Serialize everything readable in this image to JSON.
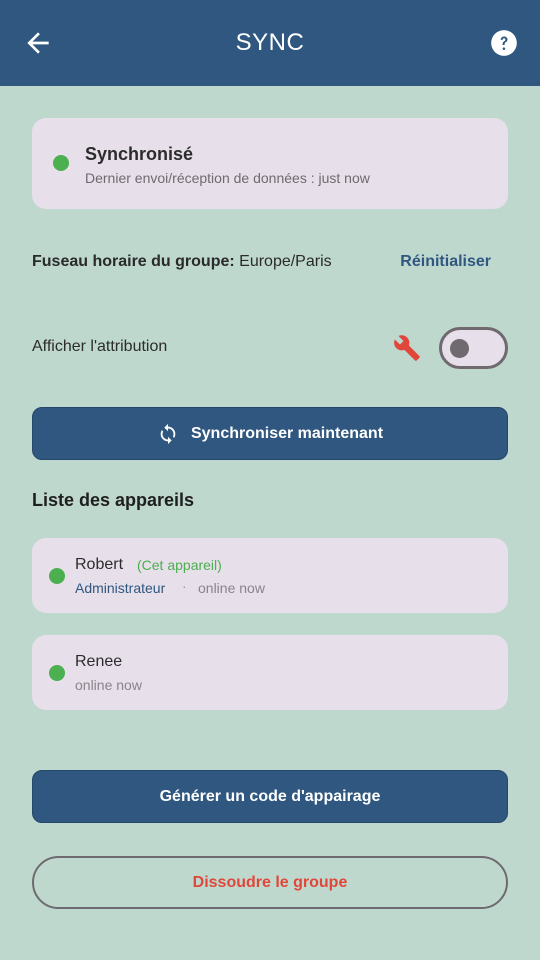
{
  "header": {
    "title": "SYNC",
    "back_icon": "arrow-left-icon",
    "help_icon": "help-circle-icon"
  },
  "status": {
    "title": "Synchronisé",
    "subtitle_label": "Dernier envoi/réception de données :",
    "subtitle_value": "just now",
    "indicator_color": "#4caf50"
  },
  "timezone": {
    "label": "Fuseau horaire du groupe:",
    "value": "Europe/Paris",
    "reset_label": "Réinitialiser"
  },
  "attribution": {
    "label": "Afficher l'attribution",
    "enabled": false,
    "wrench_color": "#e0473a"
  },
  "sync_button": {
    "label": "Synchroniser maintenant",
    "icon": "sync-icon"
  },
  "devices": {
    "title": "Liste des appareils",
    "items": [
      {
        "name": "Robert",
        "tag": "(Cet appareil)",
        "role": "Administrateur",
        "separator": "·",
        "status": "online now"
      },
      {
        "name": "Renee",
        "status": "online now"
      }
    ]
  },
  "pair_button": {
    "label": "Générer un code d'appairage"
  },
  "dissolve_button": {
    "label": "Dissoudre le groupe"
  },
  "colors": {
    "primary": "#2f5780",
    "background": "#bfd8ce",
    "card": "#e7dfe9",
    "danger": "#e0473a",
    "online": "#4caf50"
  }
}
